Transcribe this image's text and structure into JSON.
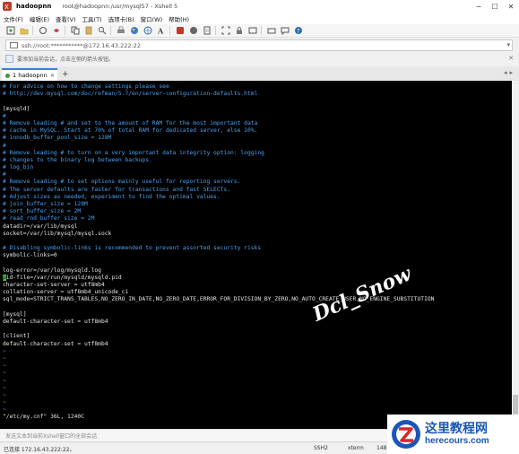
{
  "window": {
    "app_name": "hadoopnn",
    "subtitle": "root@hadoopnn:/usr/mysql57 - Xshell 5",
    "minimize": "─",
    "maximize": "☐",
    "close": "✕"
  },
  "menu": {
    "items": [
      "文件(F)",
      "编辑(E)",
      "查看(V)",
      "工具(T)",
      "选项卡(B)",
      "窗口(W)",
      "帮助(H)"
    ]
  },
  "address": {
    "value": "ssh://root:***********@172.16.43.222:22"
  },
  "hint": {
    "text": "要添加当前会话，点击左侧的箭头按钮。"
  },
  "tabs": [
    {
      "label": "1 hadoopnn"
    }
  ],
  "tab_add": "+",
  "terminal": {
    "lines": [
      {
        "text": "# For advice on how to change settings please see",
        "type": "comment"
      },
      {
        "text": "# http://dev.mysql.com/doc/refman/5.7/en/server-configuration-defaults.html",
        "type": "comment"
      },
      {
        "text": "",
        "type": "normal"
      },
      {
        "text": "[mysqld]",
        "type": "normal"
      },
      {
        "text": "#",
        "type": "comment"
      },
      {
        "text": "# Remove leading # and set to the amount of RAM for the most important data",
        "type": "comment"
      },
      {
        "text": "# cache in MySQL. Start at 70% of total RAM for dedicated server, else 10%.",
        "type": "comment"
      },
      {
        "text": "# innodb_buffer_pool_size = 128M",
        "type": "comment"
      },
      {
        "text": "#",
        "type": "comment"
      },
      {
        "text": "# Remove leading # to turn on a very important data integrity option: logging",
        "type": "comment"
      },
      {
        "text": "# changes to the binary log between backups.",
        "type": "comment"
      },
      {
        "text": "# log_bin",
        "type": "comment"
      },
      {
        "text": "#",
        "type": "comment"
      },
      {
        "text": "# Remove leading # to set options mainly useful for reporting servers.",
        "type": "comment"
      },
      {
        "text": "# The server defaults are faster for transactions and fast SELECTs.",
        "type": "comment"
      },
      {
        "text": "# Adjust sizes as needed, experiment to find the optimal values.",
        "type": "comment"
      },
      {
        "text": "# join_buffer_size = 128M",
        "type": "comment"
      },
      {
        "text": "# sort_buffer_size = 2M",
        "type": "comment"
      },
      {
        "text": "# read_rnd_buffer_size = 2M",
        "type": "comment"
      },
      {
        "text": "datadir=/var/lib/mysql",
        "type": "normal"
      },
      {
        "text": "socket=/var/lib/mysql/mysql.sock",
        "type": "normal"
      },
      {
        "text": "",
        "type": "normal"
      },
      {
        "text": "# Disabling symbolic-links is recommended to prevent assorted security risks",
        "type": "comment"
      },
      {
        "text": "symbolic-links=0",
        "type": "normal"
      },
      {
        "text": "",
        "type": "normal"
      },
      {
        "text": "log-error=/var/log/mysqld.log",
        "type": "normal"
      },
      {
        "text": "pid-file=/var/run/mysqld/mysqld.pid",
        "type": "cursor"
      },
      {
        "text": "character-set-server = utf8mb4",
        "type": "normal"
      },
      {
        "text": "collation-server = utf8mb4_unicode_ci",
        "type": "normal"
      },
      {
        "text": "sql_mode=STRICT_TRANS_TABLES,NO_ZERO_IN_DATE,NO_ZERO_DATE,ERROR_FOR_DIVISION_BY_ZERO,NO_AUTO_CREATE_USER,NO_ENGINE_SUBSTITUTION",
        "type": "normal"
      },
      {
        "text": "",
        "type": "normal"
      },
      {
        "text": "[mysql]",
        "type": "normal"
      },
      {
        "text": "default-character-set = utf8mb4",
        "type": "normal"
      },
      {
        "text": "",
        "type": "normal"
      },
      {
        "text": "[client]",
        "type": "normal"
      },
      {
        "text": "default-character-set = utf8mb4",
        "type": "normal"
      },
      {
        "text": "~",
        "type": "tilde"
      },
      {
        "text": "~",
        "type": "tilde"
      },
      {
        "text": "~",
        "type": "tilde"
      },
      {
        "text": "~",
        "type": "tilde"
      },
      {
        "text": "~",
        "type": "tilde"
      },
      {
        "text": "~",
        "type": "tilde"
      },
      {
        "text": "~",
        "type": "tilde"
      },
      {
        "text": "~",
        "type": "tilde"
      },
      {
        "text": "~",
        "type": "tilde"
      },
      {
        "text": "\"/etc/my.cnf\" 36L, 1240C",
        "type": "normal"
      }
    ]
  },
  "watermark": "Dcl_Snow",
  "sendbar": {
    "text": "发送文本到当前Xshell窗口的全部会话"
  },
  "status": {
    "connection": "已连接 172.16.43.222:22。",
    "protocol": "SSH2",
    "terminal_type": "xterm",
    "size": "148"
  },
  "logo": {
    "cn": "这里教程网",
    "en": "herecours.com"
  }
}
